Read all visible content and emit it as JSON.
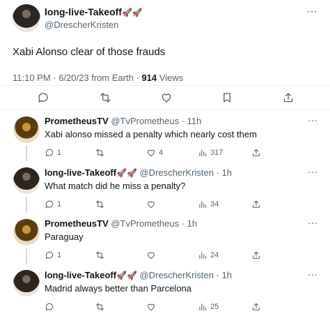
{
  "main_tweet": {
    "display_name": "long-live-Takeoff",
    "name_emojis": "🚀🚀",
    "handle": "@DrescherKristen",
    "text": "Xabi Alonso clear of those frauds",
    "time_and_source": "11:10 PM · 6/20/23 from Earth · ",
    "views_count": "914",
    "views_label": " Views"
  },
  "replies": [
    {
      "display_name": "PrometheusTV",
      "name_emojis": "",
      "meta": " @TvPrometheus · 11h",
      "text": "Xabi alonso missed a penalty which nearly cost them",
      "replies_count": "1",
      "retweets_count": "",
      "likes_count": "4",
      "views_count": "317"
    },
    {
      "display_name": "long-live-Takeoff",
      "name_emojis": "🚀🚀",
      "meta": " @DrescherKristen · 1h",
      "text": "What match did he miss a penalty?",
      "replies_count": "1",
      "retweets_count": "",
      "likes_count": "",
      "views_count": "34"
    },
    {
      "display_name": "PrometheusTV",
      "name_emojis": "",
      "meta": " @TvPrometheus · 1h",
      "text": "Paraguay",
      "replies_count": "1",
      "retweets_count": "",
      "likes_count": "",
      "views_count": "24"
    },
    {
      "display_name": "long-live-Takeoff",
      "name_emojis": "🚀🚀",
      "meta": " @DrescherKristen · 1h",
      "text": "Madrid always better than Parcelona",
      "replies_count": "",
      "retweets_count": "",
      "likes_count": "",
      "views_count": "25"
    }
  ],
  "more_icon_glyph": "···",
  "colors": {
    "text": "#0f1419",
    "secondary": "#536471",
    "divider": "#eff3f4",
    "thread_line": "#cfd9de"
  }
}
